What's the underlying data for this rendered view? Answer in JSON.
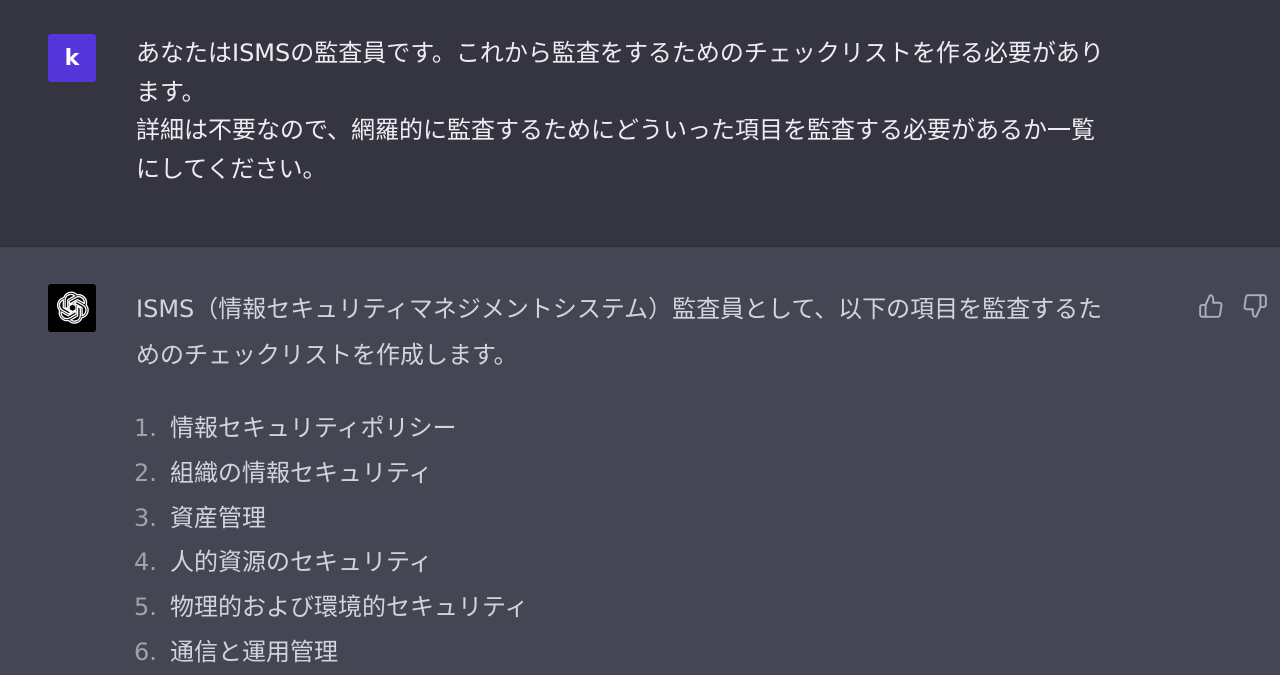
{
  "user_message": {
    "avatar_letter": "k",
    "avatar_color": "#5436da",
    "lines": [
      "あなたはISMSの監査員です。これから監査をするためのチェックリストを作る必要があり",
      "ます。",
      "詳細は不要なので、網羅的に監査するためにどういった項目を監査する必要があるか一覧",
      "にしてください。"
    ]
  },
  "assistant_message": {
    "avatar_icon": "openai-logo-icon",
    "intro_lines": [
      "ISMS（情報セキュリティマネジメントシステム）監査員として、以下の項目を監査するた",
      "めのチェックリストを作成します。"
    ],
    "list": [
      {
        "num": "1.",
        "text": "情報セキュリティポリシー"
      },
      {
        "num": "2.",
        "text": "組織の情報セキュリティ"
      },
      {
        "num": "3.",
        "text": "資産管理"
      },
      {
        "num": "4.",
        "text": "人的資源のセキュリティ"
      },
      {
        "num": "5.",
        "text": "物理的および環境的セキュリティ"
      },
      {
        "num": "6.",
        "text": "通信と運用管理"
      }
    ],
    "feedback_icons": [
      "thumbs-up-icon",
      "thumbs-down-icon"
    ]
  },
  "colors": {
    "user_bg": "#343541",
    "assistant_bg": "#444654",
    "text": "#ececf1"
  }
}
